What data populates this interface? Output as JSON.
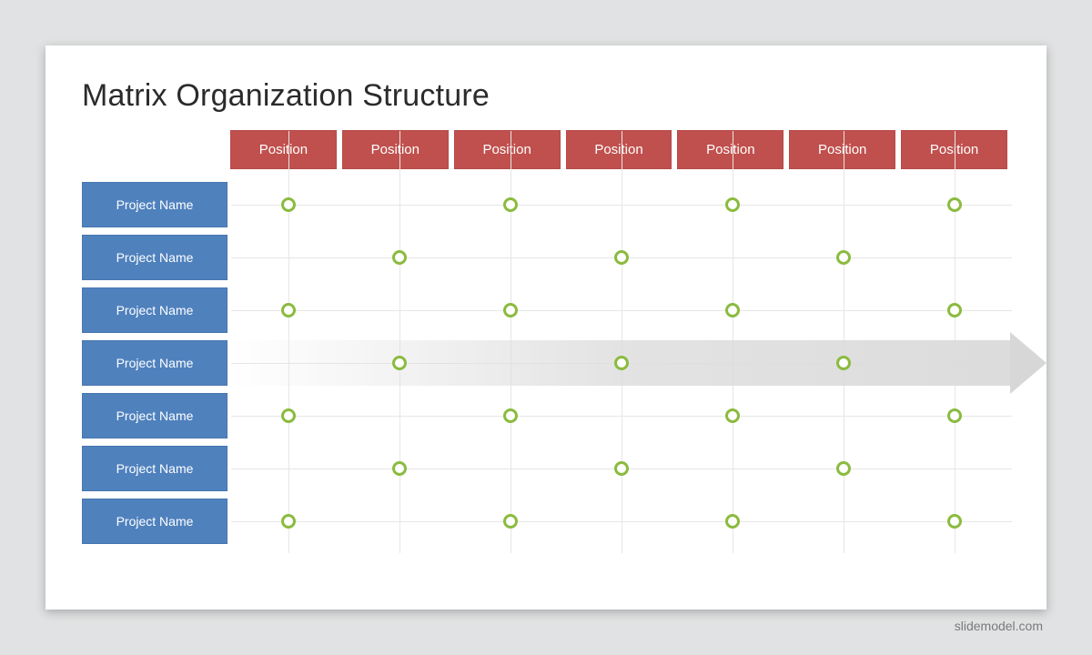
{
  "title": "Matrix Organization Structure",
  "columns": [
    "Position",
    "Position",
    "Position",
    "Position",
    "Position",
    "Position",
    "Position"
  ],
  "rows": [
    "Project Name",
    "Project Name",
    "Project Name",
    "Project Name",
    "Project Name",
    "Project Name",
    "Project Name"
  ],
  "dots": [
    [
      true,
      false,
      true,
      false,
      true,
      false,
      true
    ],
    [
      false,
      true,
      false,
      true,
      false,
      true,
      false
    ],
    [
      true,
      false,
      true,
      false,
      true,
      false,
      true
    ],
    [
      false,
      true,
      false,
      true,
      false,
      true,
      false
    ],
    [
      true,
      false,
      true,
      false,
      true,
      false,
      true
    ],
    [
      false,
      true,
      false,
      true,
      false,
      true,
      false
    ],
    [
      true,
      false,
      true,
      false,
      true,
      false,
      true
    ]
  ],
  "highlight_row": 3,
  "attribution": "slidemodel.com",
  "colors": {
    "col_header": "#c0504d",
    "row_header": "#4f81bd",
    "dot": "#8bbb3f",
    "arrow": "#d7d7d7"
  }
}
